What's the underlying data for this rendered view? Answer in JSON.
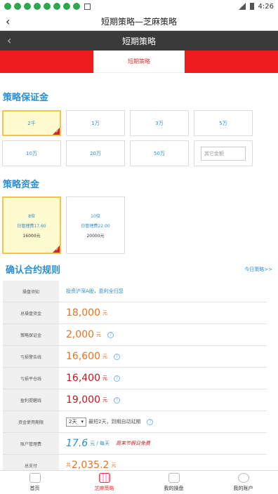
{
  "status_bar": {
    "time": "4:26"
  },
  "app_header": {
    "title": "短期策略—芝麻策略"
  },
  "inner_header": {
    "title": "短期策略"
  },
  "tab": {
    "active_label": "短期策略"
  },
  "margin_section": {
    "title": "策略保证金",
    "options": [
      "2千",
      "1万",
      "3万",
      "5万",
      "10万",
      "20万",
      "50万"
    ],
    "selected": "2千",
    "other_placeholder": "其它金额"
  },
  "fund_section": {
    "title": "策略资金",
    "cards": [
      {
        "multiple": "8倍",
        "fee": "日管理费17.60",
        "amount": "16000元",
        "selected": true
      },
      {
        "multiple": "10倍",
        "fee": "日管理费22.00",
        "amount": "20000元",
        "selected": false
      }
    ]
  },
  "rules": {
    "title": "确认合约规则",
    "link": "今日策略>>",
    "rows": [
      {
        "label": "操盘须知",
        "text": "投资沪深A股，盈利全归您"
      },
      {
        "label": "总操盘资金",
        "value": "18,000",
        "unit": "元"
      },
      {
        "label": "策略保证金",
        "value": "2,000",
        "unit": "元"
      },
      {
        "label": "亏损警告线",
        "value": "16,600",
        "unit": "元"
      },
      {
        "label": "亏损平仓线",
        "value": "16,400",
        "unit": "元"
      },
      {
        "label": "盈利提醒线",
        "value": "19,000",
        "unit": "元"
      },
      {
        "label": "资金使用期限",
        "select": "2天",
        "note": "最短2天，到期自动延期"
      },
      {
        "label": "账户管理费",
        "value": "17.6",
        "unit": "元 / 每天",
        "promo": "周末节假日免费"
      },
      {
        "label": "总支付",
        "prefix": "共",
        "value": "2,035.2",
        "unit": "元"
      }
    ]
  },
  "bottom_nav": [
    "首页",
    "芝麻策略",
    "我的操盘",
    "我的账户"
  ],
  "colors": {
    "accent_red": "#ee1c1c",
    "heading_blue": "#2a8fd0",
    "selected_bg": "#fffbd0"
  }
}
